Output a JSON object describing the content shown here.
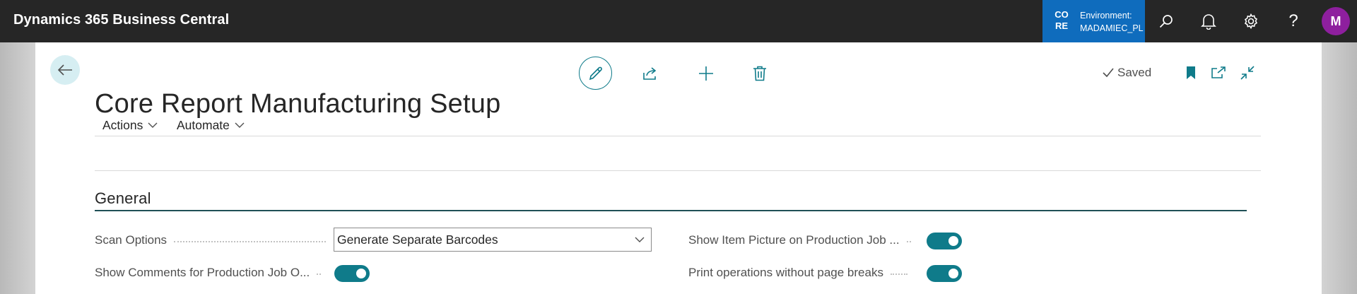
{
  "app": {
    "title": "Dynamics 365 Business Central",
    "environment_code_line1": "CO",
    "environment_code_line2": "RE",
    "environment_label": "Environment:",
    "environment_name": "MADAMIEC_PL",
    "user_initial": "M"
  },
  "icons": {
    "search": "search-icon",
    "notifications": "bell-icon",
    "settings": "gear-icon",
    "help": "help-icon",
    "back": "arrow-left-icon",
    "edit": "pencil-icon",
    "share": "share-icon",
    "new": "plus-icon",
    "delete": "trash-icon",
    "saved": "checkmark-icon",
    "bookmark": "bookmark-icon",
    "open_new_window": "open-in-new-window-icon",
    "collapse": "collapse-icon"
  },
  "colors": {
    "topbar": "#262626",
    "environment": "#0f6cbd",
    "accent": "#0f7b8a",
    "avatar": "#8e1f9e"
  },
  "page": {
    "title": "Core Report Manufacturing Setup",
    "status": "Saved",
    "menu": [
      "Actions",
      "Automate"
    ]
  },
  "general": {
    "section_title": "General",
    "scan_options_label": "Scan Options",
    "scan_options_value": "Generate Separate Barcodes",
    "show_comments_label": "Show Comments for Production Job O...",
    "show_comments_value": true,
    "show_item_picture_label": "Show Item Picture on Production Job ...",
    "show_item_picture_value": true,
    "print_operations_label": "Print operations without page breaks",
    "print_operations_value": true
  }
}
